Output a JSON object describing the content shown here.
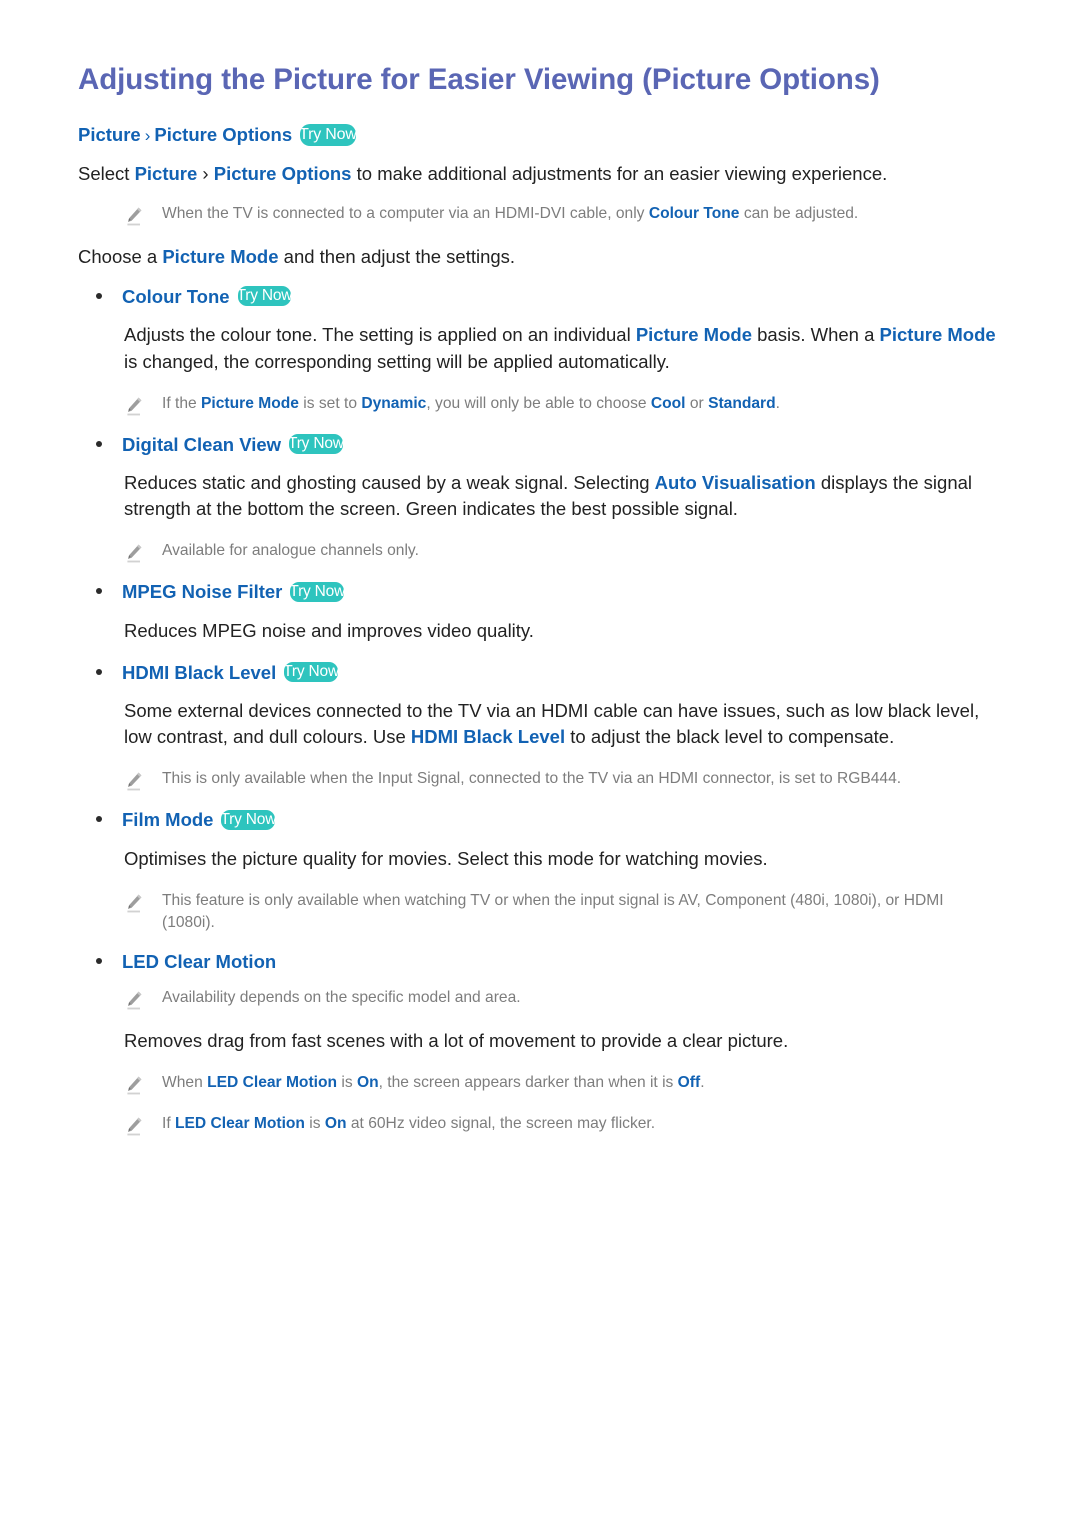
{
  "page": {
    "title": "Adjusting the Picture for Easier Viewing (Picture Options)",
    "try_now_label": "Try Now",
    "breadcrumb": {
      "first": "Picture",
      "separator": "›",
      "second": "Picture Options"
    },
    "intro": {
      "lead": "Select ",
      "link1": "Picture",
      "separator": " › ",
      "link2": "Picture Options",
      "tail": " to make additional adjustments for an easier viewing experience."
    },
    "intro_note": {
      "pre": "When the TV is connected to a computer via an HDMI-DVI cable, only ",
      "link": "Colour Tone",
      "post": " can be adjusted."
    },
    "choose_line": {
      "pre": "Choose a ",
      "link": "Picture Mode",
      "post": " and then adjust the settings."
    },
    "sections": [
      {
        "name": "colour-tone",
        "label": "Colour Tone",
        "has_try_now": true,
        "body": [
          {
            "type": "para",
            "segments": [
              {
                "t": "text",
                "v": "Adjusts the colour tone. The setting is applied on an individual "
              },
              {
                "t": "link",
                "v": "Picture Mode"
              },
              {
                "t": "text",
                "v": " basis. When a "
              },
              {
                "t": "link",
                "v": "Picture Mode"
              },
              {
                "t": "text",
                "v": " is changed, the corresponding setting will be applied automatically."
              }
            ]
          },
          {
            "type": "note",
            "segments": [
              {
                "t": "text",
                "v": "If the "
              },
              {
                "t": "link",
                "v": "Picture Mode"
              },
              {
                "t": "text",
                "v": " is set to "
              },
              {
                "t": "link",
                "v": "Dynamic"
              },
              {
                "t": "text",
                "v": ", you will only be able to choose "
              },
              {
                "t": "link",
                "v": "Cool"
              },
              {
                "t": "text",
                "v": " or "
              },
              {
                "t": "link",
                "v": "Standard"
              },
              {
                "t": "text",
                "v": "."
              }
            ]
          }
        ]
      },
      {
        "name": "digital-clean-view",
        "label": "Digital Clean View",
        "has_try_now": true,
        "body": [
          {
            "type": "para",
            "segments": [
              {
                "t": "text",
                "v": "Reduces static and ghosting caused by a weak signal. Selecting "
              },
              {
                "t": "link",
                "v": "Auto Visualisation"
              },
              {
                "t": "text",
                "v": " displays the signal strength at the bottom the screen. Green indicates the best possible signal."
              }
            ]
          },
          {
            "type": "note",
            "segments": [
              {
                "t": "text",
                "v": "Available for analogue channels only."
              }
            ]
          }
        ]
      },
      {
        "name": "mpeg-noise-filter",
        "label": "MPEG Noise Filter",
        "has_try_now": true,
        "body": [
          {
            "type": "para",
            "segments": [
              {
                "t": "text",
                "v": "Reduces MPEG noise and improves video quality."
              }
            ]
          }
        ]
      },
      {
        "name": "hdmi-black-level",
        "label": "HDMI Black Level",
        "has_try_now": true,
        "body": [
          {
            "type": "para",
            "segments": [
              {
                "t": "text",
                "v": "Some external devices connected to the TV via an HDMI cable can have issues, such as low black level, low contrast, and dull colours. Use "
              },
              {
                "t": "link",
                "v": "HDMI Black Level"
              },
              {
                "t": "text",
                "v": " to adjust the black level to compensate."
              }
            ]
          },
          {
            "type": "note",
            "segments": [
              {
                "t": "text",
                "v": "This is only available when the Input Signal, connected to the TV via an HDMI connector, is set to RGB444."
              }
            ]
          }
        ]
      },
      {
        "name": "film-mode",
        "label": "Film Mode",
        "has_try_now": true,
        "body": [
          {
            "type": "para",
            "segments": [
              {
                "t": "text",
                "v": "Optimises the picture quality for movies. Select this mode for watching movies."
              }
            ]
          },
          {
            "type": "note",
            "segments": [
              {
                "t": "text",
                "v": "This feature is only available when watching TV or when the input signal is AV, Component (480i, 1080i), or HDMI (1080i)."
              }
            ]
          }
        ]
      },
      {
        "name": "led-clear-motion",
        "label": "LED Clear Motion",
        "has_try_now": false,
        "body": [
          {
            "type": "note",
            "segments": [
              {
                "t": "text",
                "v": "Availability depends on the specific model and area."
              }
            ]
          },
          {
            "type": "para",
            "segments": [
              {
                "t": "text",
                "v": "Removes drag from fast scenes with a lot of movement to provide a clear picture."
              }
            ]
          },
          {
            "type": "note",
            "segments": [
              {
                "t": "text",
                "v": "When "
              },
              {
                "t": "link",
                "v": "LED Clear Motion"
              },
              {
                "t": "text",
                "v": " is "
              },
              {
                "t": "link",
                "v": "On"
              },
              {
                "t": "text",
                "v": ", the screen appears darker than when it is "
              },
              {
                "t": "link",
                "v": "Off"
              },
              {
                "t": "text",
                "v": "."
              }
            ]
          },
          {
            "type": "note",
            "segments": [
              {
                "t": "text",
                "v": "If "
              },
              {
                "t": "link",
                "v": "LED Clear Motion"
              },
              {
                "t": "text",
                "v": " is "
              },
              {
                "t": "link",
                "v": "On"
              },
              {
                "t": "text",
                "v": " at 60Hz video signal, the screen may flicker."
              }
            ]
          }
        ]
      }
    ]
  },
  "colors": {
    "title": "#5a66b4",
    "link": "#1262b3",
    "badge": "#2ec4be",
    "note_text": "#7d7d7d",
    "body_text": "#222222"
  }
}
